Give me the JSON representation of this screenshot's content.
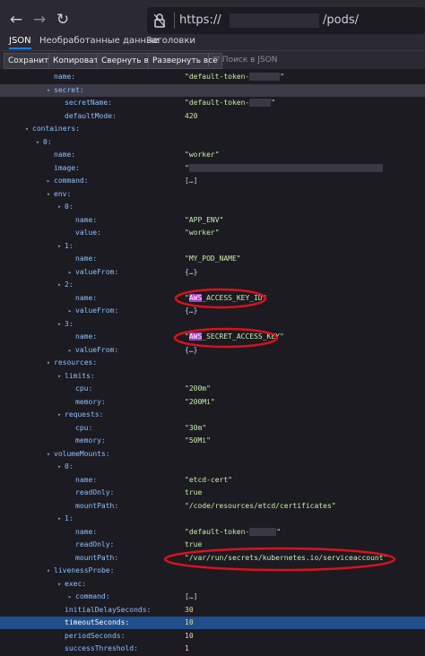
{
  "browser": {
    "url_prefix": "https://",
    "url_suffix": "/pods/",
    "back_icon": "arrow-left-icon",
    "forward_icon": "arrow-right-icon",
    "reload_icon": "reload-icon",
    "lock_icon": "lock-icon"
  },
  "tabs": [
    {
      "label": "JSON",
      "active": true
    },
    {
      "label": "Необработанные данные",
      "active": false
    },
    {
      "label": "Заголовки",
      "active": false
    }
  ],
  "toolbar": {
    "save": "Сохранить",
    "copy": "Копировать",
    "collapse": "Свернуть все",
    "expand": "Развернуть все",
    "filter_placeholder": "Поиск в JSON"
  },
  "rows": [
    {
      "k": "name:",
      "v": "\"default-token-",
      "r": 34,
      "t": "\"",
      "vt": "str",
      "indent": 4
    },
    {
      "k": "secret:",
      "tw": "▾",
      "hl": true,
      "indent": 4
    },
    {
      "k": "secretName:",
      "v": "\"default-token-",
      "r": 24,
      "t": "\"",
      "vt": "str",
      "indent": 5
    },
    {
      "k": "defaultMode:",
      "v": "420",
      "vt": "num",
      "indent": 5
    },
    {
      "k": "containers:",
      "tw": "▾",
      "indent": 2
    },
    {
      "k": "0:",
      "tw": "▾",
      "indent": 3
    },
    {
      "k": "name:",
      "v": "\"worker\"",
      "vt": "str",
      "indent": 4
    },
    {
      "k": "image:",
      "v": "\"",
      "r": 216,
      "t": "",
      "vt": "str",
      "indent": 4
    },
    {
      "k": "command:",
      "tw": "▸",
      "v": "[…]",
      "vt": "lnk",
      "indent": 4
    },
    {
      "k": "env:",
      "tw": "▾",
      "indent": 4
    },
    {
      "k": "0:",
      "tw": "▾",
      "indent": 5
    },
    {
      "k": "name:",
      "v": "\"APP_ENV\"",
      "vt": "str",
      "indent": 6
    },
    {
      "k": "value:",
      "v": "\"worker\"",
      "vt": "str",
      "indent": 6
    },
    {
      "k": "1:",
      "tw": "▾",
      "indent": 5
    },
    {
      "k": "name:",
      "v": "\"MY_POD_NAME\"",
      "vt": "str",
      "indent": 6
    },
    {
      "k": "valueFrom:",
      "tw": "▸",
      "v": "{…}",
      "vt": "lnk",
      "indent": 6
    },
    {
      "k": "2:",
      "tw": "▾",
      "indent": 5
    },
    {
      "k": "name:",
      "v": "\"",
      "hi": "AWS",
      "t": "_ACCESS_KEY_ID\"",
      "vt": "str",
      "indent": 6
    },
    {
      "k": "valueFrom:",
      "tw": "▸",
      "v": "{…}",
      "vt": "lnk",
      "indent": 6
    },
    {
      "k": "3:",
      "tw": "▾",
      "indent": 5
    },
    {
      "k": "name:",
      "v": "\"",
      "hi": "AWS",
      "t": "_SECRET_ACCESS_KEY\"",
      "vt": "str",
      "indent": 6
    },
    {
      "k": "valueFrom:",
      "tw": "▸",
      "v": "{…}",
      "vt": "lnk",
      "indent": 6
    },
    {
      "k": "resources:",
      "tw": "▾",
      "indent": 4
    },
    {
      "k": "limits:",
      "tw": "▾",
      "indent": 5
    },
    {
      "k": "cpu:",
      "v": "\"200m\"",
      "vt": "str",
      "indent": 6
    },
    {
      "k": "memory:",
      "v": "\"200Mi\"",
      "vt": "str",
      "indent": 6
    },
    {
      "k": "requests:",
      "tw": "▾",
      "indent": 5
    },
    {
      "k": "cpu:",
      "v": "\"30m\"",
      "vt": "str",
      "indent": 6
    },
    {
      "k": "memory:",
      "v": "\"50Mi\"",
      "vt": "str",
      "indent": 6
    },
    {
      "k": "volumeMounts:",
      "tw": "▾",
      "indent": 4
    },
    {
      "k": "0:",
      "tw": "▾",
      "indent": 5
    },
    {
      "k": "name:",
      "v": "\"etcd-cert\"",
      "vt": "str",
      "indent": 6
    },
    {
      "k": "readOnly:",
      "v": "true",
      "vt": "bool",
      "indent": 6
    },
    {
      "k": "mountPath:",
      "v": "\"/code/resources/etcd/certificates\"",
      "vt": "str",
      "indent": 6
    },
    {
      "k": "1:",
      "tw": "▾",
      "indent": 5
    },
    {
      "k": "name:",
      "v": "\"default-token-",
      "r": 30,
      "t": "\"",
      "vt": "str",
      "indent": 6
    },
    {
      "k": "readOnly:",
      "v": "true",
      "vt": "bool",
      "indent": 6
    },
    {
      "k": "mountPath:",
      "v": "\"/var/run/secrets/kubernetes.io/serviceaccount\"",
      "vt": "str",
      "indent": 6
    },
    {
      "k": "livenessProbe:",
      "tw": "▾",
      "indent": 4
    },
    {
      "k": "exec:",
      "tw": "▾",
      "indent": 5
    },
    {
      "k": "command:",
      "tw": "▸",
      "v": "[…]",
      "vt": "lnk",
      "indent": 6
    },
    {
      "k": "initialDelaySeconds:",
      "v": "30",
      "vt": "num",
      "indent": 5
    },
    {
      "k": "timeoutSeconds:",
      "v": "10",
      "vt": "num",
      "sel": true,
      "indent": 5
    },
    {
      "k": "periodSeconds:",
      "v": "10",
      "vt": "num",
      "indent": 5
    },
    {
      "k": "successThreshold:",
      "v": "1",
      "vt": "num",
      "indent": 5
    }
  ]
}
